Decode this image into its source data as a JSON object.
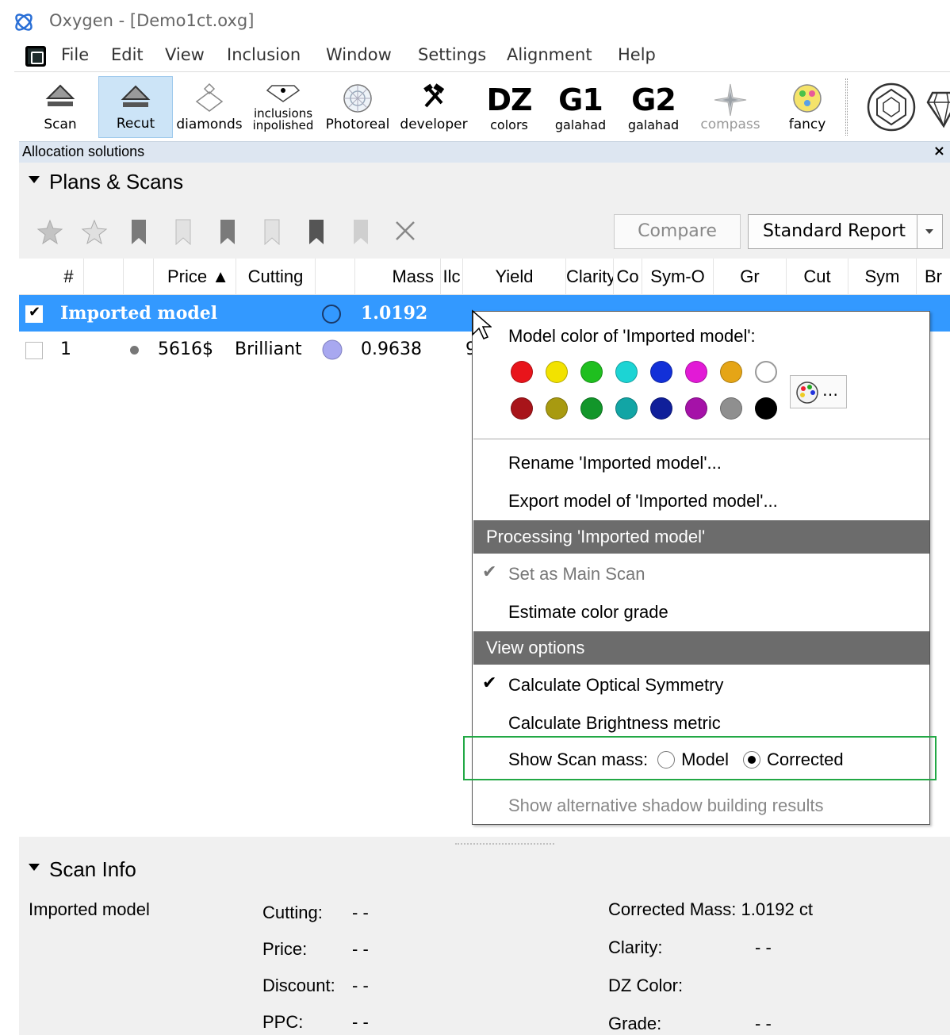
{
  "window": {
    "title": "Oxygen - [Demo1ct.oxg]"
  },
  "menu": [
    "File",
    "Edit",
    "View",
    "Inclusion",
    "Window",
    "Settings",
    "Alignment",
    "Help"
  ],
  "toolbar": {
    "scan": "Scan",
    "recut": "Recut",
    "diamonds": "diamonds",
    "inclusions_1": "inclusions",
    "inclusions_2": "inpolished",
    "photoreal": "Photoreal",
    "developer": "developer",
    "dz_big": "DZ",
    "dz_small": "colors",
    "g1_big": "G1",
    "g1_small": "galahad",
    "g2_big": "G2",
    "g2_small": "galahad",
    "compass": "compass",
    "fancy": "fancy"
  },
  "panel": {
    "title": "Allocation solutions",
    "close": "×"
  },
  "plans": {
    "section_title": "Plans & Scans",
    "compare": "Compare",
    "report": "Standard Report",
    "columns": {
      "num": "#",
      "price": "Price ▲",
      "cutting": "Cutting",
      "mass": "Mass",
      "ilc": "Ilc",
      "yield": "Yield",
      "clarity": "Clarity",
      "co": "Co",
      "symo": "Sym-O",
      "gr": "Gr",
      "cut": "Cut",
      "sym": "Sym",
      "br": "Br"
    },
    "rows": [
      {
        "name": "Imported model",
        "mass": "1.0192"
      },
      {
        "num": "1",
        "price": "5616$",
        "cutting": "Brilliant",
        "mass": "0.9638",
        "yield_partial": "9"
      }
    ]
  },
  "context_menu": {
    "color_title": "Model color of 'Imported model':",
    "palette_button": "…",
    "colors_row1": [
      "#e8141b",
      "#f2e200",
      "#1fbf1f",
      "#1cd4d4",
      "#1230d8",
      "#e21ad6",
      "#e5a516",
      "#ffffff"
    ],
    "colors_row2": [
      "#a8141a",
      "#a89a10",
      "#12962a",
      "#12a5a5",
      "#101f9a",
      "#a512a8",
      "#8f8f8f",
      "#000000"
    ],
    "rename": "Rename 'Imported model'...",
    "export": "Export model of 'Imported model'...",
    "processing_header": "Processing 'Imported model'",
    "set_main": "Set as Main Scan",
    "estimate": "Estimate color grade",
    "view_header": "View options",
    "optical": "Calculate Optical Symmetry",
    "brightness": "Calculate Brightness metric",
    "show_scan_mass": "Show Scan mass:",
    "opt_model": "Model",
    "opt_corrected": "Corrected",
    "show_alt": "Show alternative shadow building results",
    "check": "✔"
  },
  "scan_info": {
    "section_title": "Scan Info",
    "model_name": "Imported model",
    "cutting_label": "Cutting:",
    "cutting_value": "- -",
    "price_label": "Price:",
    "price_value": "- -",
    "discount_label": "Discount:",
    "discount_value": "- -",
    "ppc_label": "PPC:",
    "ppc_value": "- -",
    "corrected_mass": "Corrected Mass: 1.0192 ct",
    "clarity_label": "Clarity:",
    "clarity_value": "- -",
    "dz_color_label": "DZ Color:",
    "grade_label": "Grade:",
    "grade_value": "- -"
  }
}
